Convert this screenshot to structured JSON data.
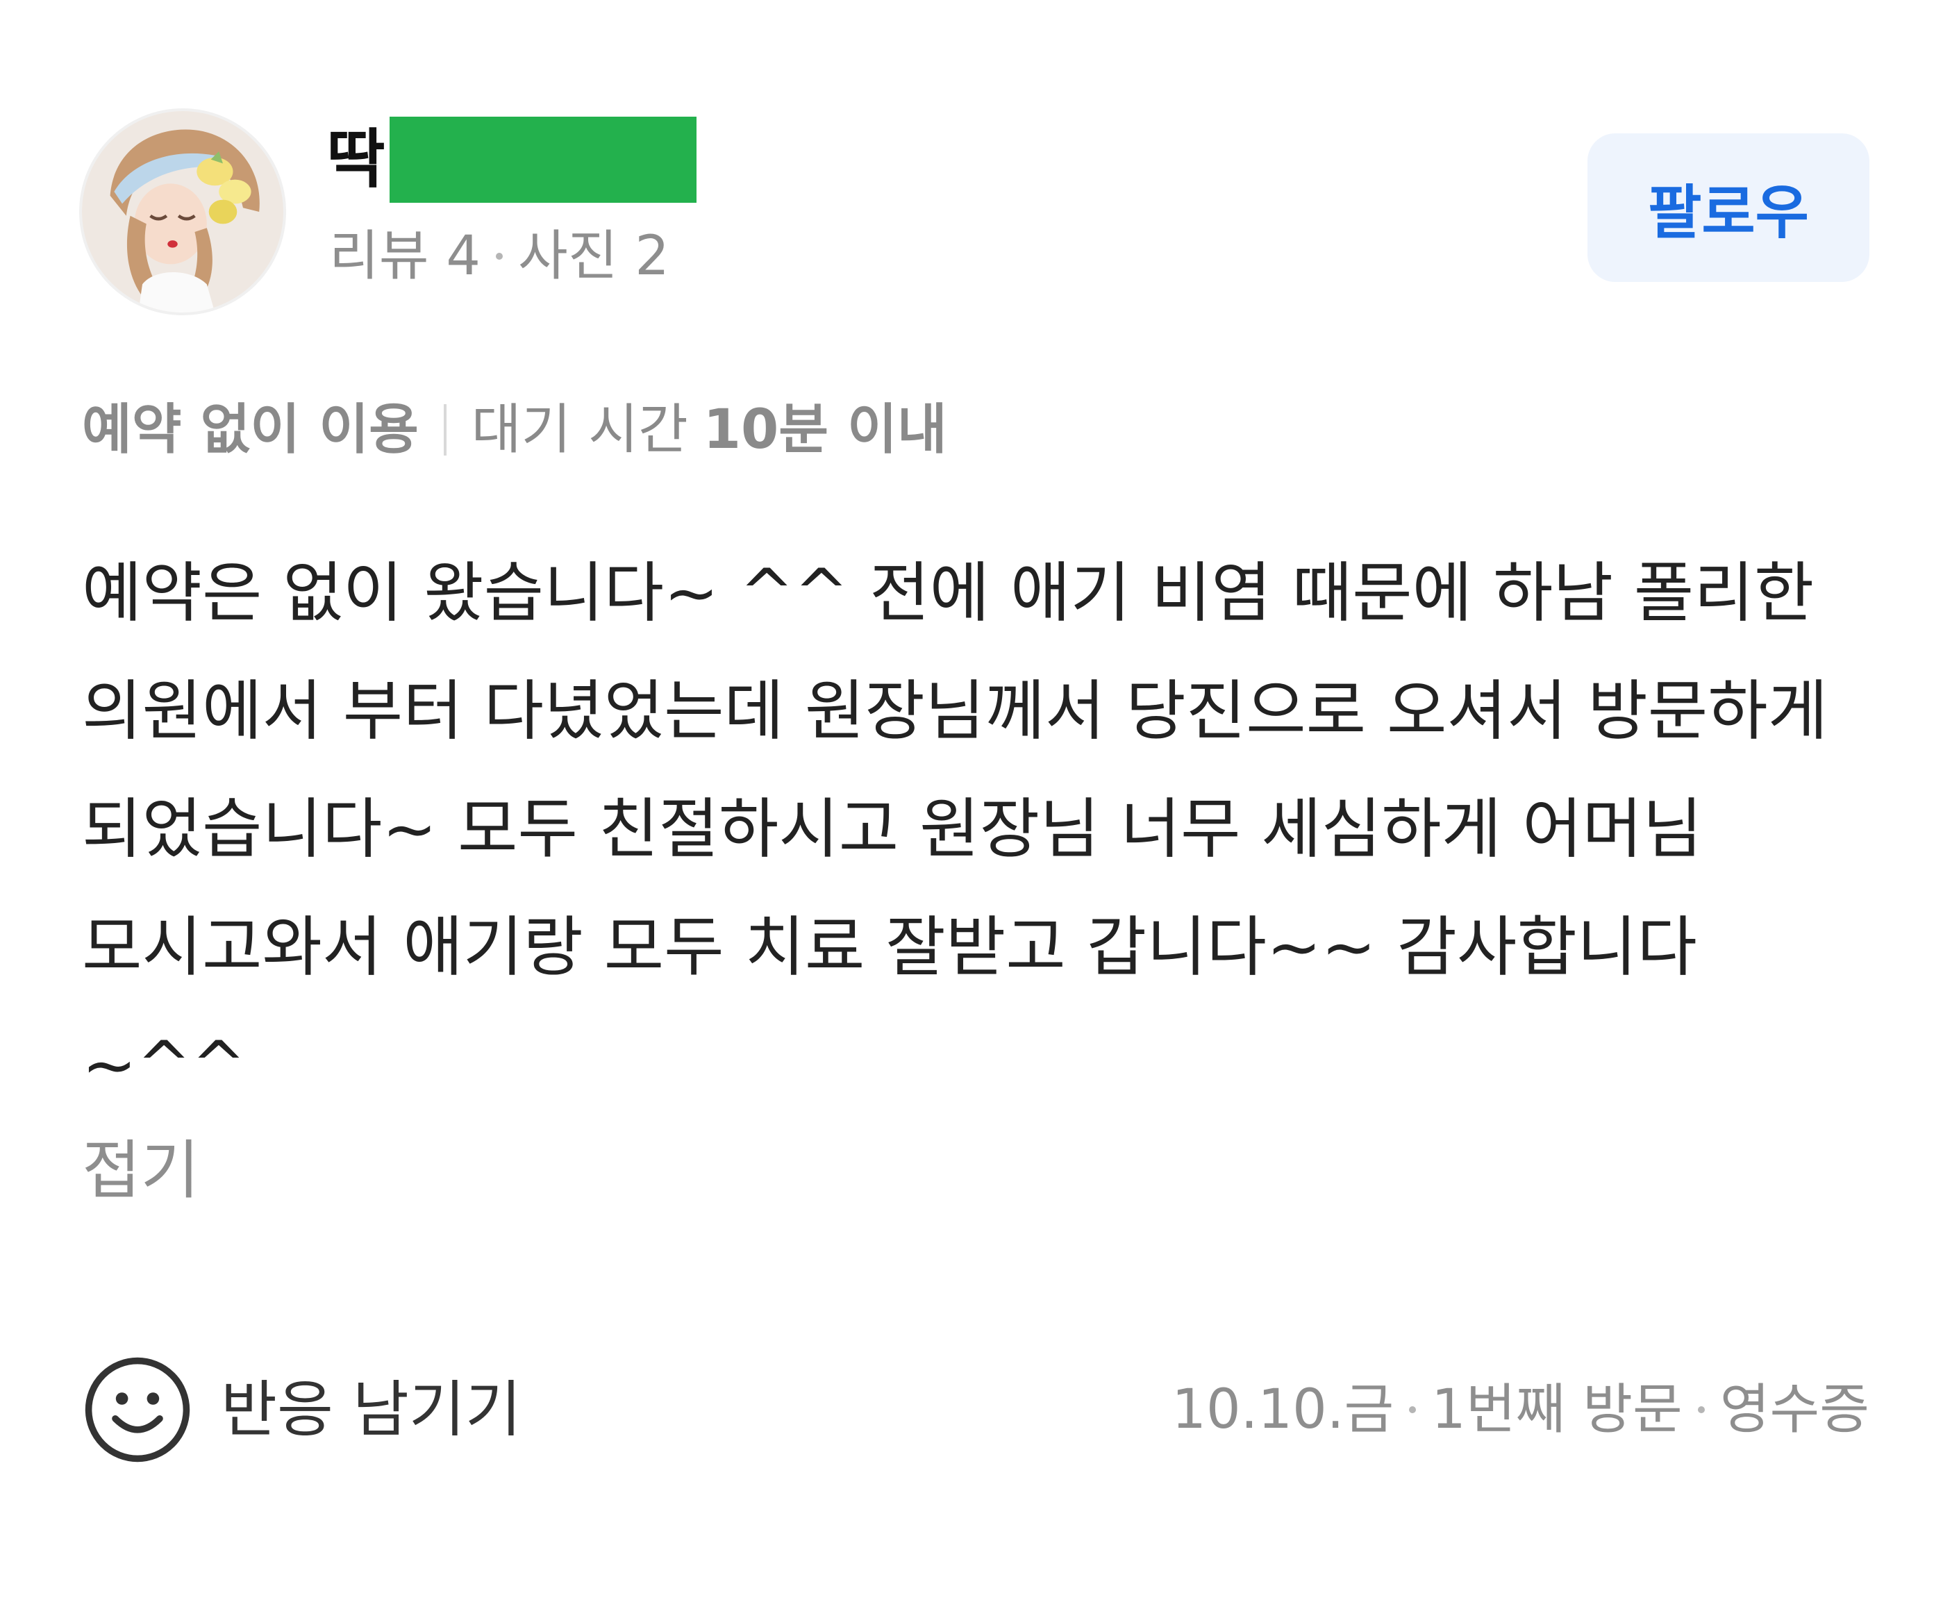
{
  "colors": {
    "follow_bg": "#eef4fd",
    "follow_text": "#1a6be0",
    "redaction": "#23b14d",
    "muted_text": "#8e8e8e"
  },
  "user": {
    "avatar_icon": "profile-avatar",
    "name_visible": "딱",
    "stats": {
      "reviews": "리뷰 4",
      "photos": "사진 2"
    }
  },
  "follow_label": "팔로우",
  "tags": {
    "reservation": "예약 없이 이용",
    "wait_prefix": "대기 시간",
    "wait_value": "10분 이내"
  },
  "review": {
    "text": "예약은 없이 왔습니다~ ^^ 전에 애기 비염 때문에 하남 폴리한 의원에서 부터 다녔었는데 원장님께서 당진으로 오셔서 방문하게 되었습니다~ 모두 친절하시고 원장님 너무 세심하게 어머님 모시고와서 애기랑 모두 치료 잘받고 갑니다~~ 감사합니다 ~^^",
    "fold_label": "접기"
  },
  "footer": {
    "reaction_icon": "smile-icon",
    "reaction_label": "반응 남기기",
    "date": "10.10.금",
    "visit_count": "1번째 방문",
    "receipt": "영수증"
  }
}
